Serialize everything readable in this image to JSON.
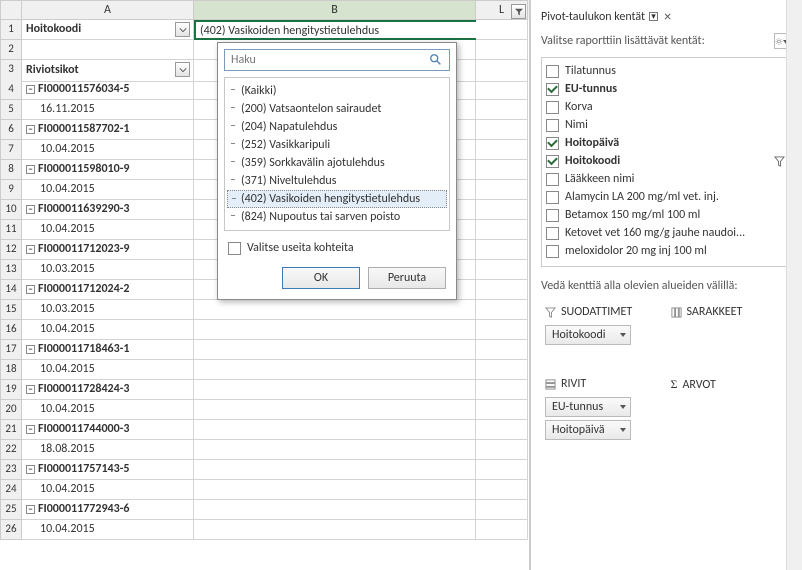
{
  "columns": {
    "A": "A",
    "B": "B",
    "L": "L"
  },
  "header": {
    "A": "Hoitokoodi",
    "B": "(402) Vasikoiden hengitystietulehdus"
  },
  "pivotLabel": "Riviotsikot",
  "rows": [
    {
      "n": 4,
      "t": "g",
      "v": "FI000011576034-5"
    },
    {
      "n": 5,
      "t": "d",
      "v": "16.11.2015"
    },
    {
      "n": 6,
      "t": "g",
      "v": "FI000011587702-1"
    },
    {
      "n": 7,
      "t": "d",
      "v": "10.04.2015"
    },
    {
      "n": 8,
      "t": "g",
      "v": "FI000011598010-9"
    },
    {
      "n": 9,
      "t": "d",
      "v": "10.04.2015"
    },
    {
      "n": 10,
      "t": "g",
      "v": "FI000011639290-3"
    },
    {
      "n": 11,
      "t": "d",
      "v": "10.04.2015"
    },
    {
      "n": 12,
      "t": "g",
      "v": "FI000011712023-9"
    },
    {
      "n": 13,
      "t": "d",
      "v": "10.03.2015"
    },
    {
      "n": 14,
      "t": "g",
      "v": "FI000011712024-2"
    },
    {
      "n": 15,
      "t": "d",
      "v": "10.03.2015"
    },
    {
      "n": 16,
      "t": "d",
      "v": "10.04.2015"
    },
    {
      "n": 17,
      "t": "g",
      "v": "FI000011718463-1"
    },
    {
      "n": 18,
      "t": "d",
      "v": "10.04.2015"
    },
    {
      "n": 19,
      "t": "g",
      "v": "FI000011728424-3"
    },
    {
      "n": 20,
      "t": "d",
      "v": "10.04.2015"
    },
    {
      "n": 21,
      "t": "g",
      "v": "FI000011744000-3"
    },
    {
      "n": 22,
      "t": "d",
      "v": "18.08.2015"
    },
    {
      "n": 23,
      "t": "g",
      "v": "FI000011757143-5"
    },
    {
      "n": 24,
      "t": "d",
      "v": "10.04.2015"
    },
    {
      "n": 25,
      "t": "g",
      "v": "FI000011772943-6"
    },
    {
      "n": 26,
      "t": "d",
      "v": "10.04.2015"
    }
  ],
  "filter": {
    "searchPlaceholder": "Haku",
    "items": [
      "(Kaikki)",
      "(200) Vatsaontelon sairaudet",
      "(204) Napatulehdus",
      "(252) Vasikkaripuli",
      "(359) Sorkkavälin ajotulehdus",
      "(371) Niveltulehdus",
      "(402) Vasikoiden hengitystietulehdus",
      "(824) Nupoutus tai sarven poisto"
    ],
    "multi": "Valitse useita kohteita",
    "ok": "OK",
    "cancel": "Peruuta"
  },
  "pane": {
    "title": "Pivot-taulukon kentät",
    "sub": "Valitse raporttiin lisättävät kentät:",
    "fields": [
      {
        "l": "Tilatunnus",
        "c": false,
        "b": false
      },
      {
        "l": "EU-tunnus",
        "c": true,
        "b": true
      },
      {
        "l": "Korva",
        "c": false,
        "b": false
      },
      {
        "l": "Nimi",
        "c": false,
        "b": false
      },
      {
        "l": "Hoitopäivä",
        "c": true,
        "b": true
      },
      {
        "l": "Hoitokoodi",
        "c": true,
        "b": true,
        "f": true
      },
      {
        "l": "Lääkkeen nimi",
        "c": false,
        "b": false
      },
      {
        "l": "Alamycin LA 200 mg/ml vet. inj.",
        "c": false,
        "b": false
      },
      {
        "l": "Betamox 150 mg/ml 100 ml",
        "c": false,
        "b": false
      },
      {
        "l": "Ketovet vet 160 mg/g jauhe naudoi...",
        "c": false,
        "b": false
      },
      {
        "l": "meloxidolor 20 mg inj 100 ml",
        "c": false,
        "b": false
      }
    ],
    "drag": "Vedä kenttiä alla olevien alueiden välillä:",
    "areas": {
      "filters": "SUODATTIMET",
      "columns": "SARAKKEET",
      "rows": "RIVIT",
      "values": "ARVOT"
    },
    "pills": {
      "filter": "Hoitokoodi",
      "row1": "EU-tunnus",
      "row2": "Hoitopäivä"
    }
  }
}
